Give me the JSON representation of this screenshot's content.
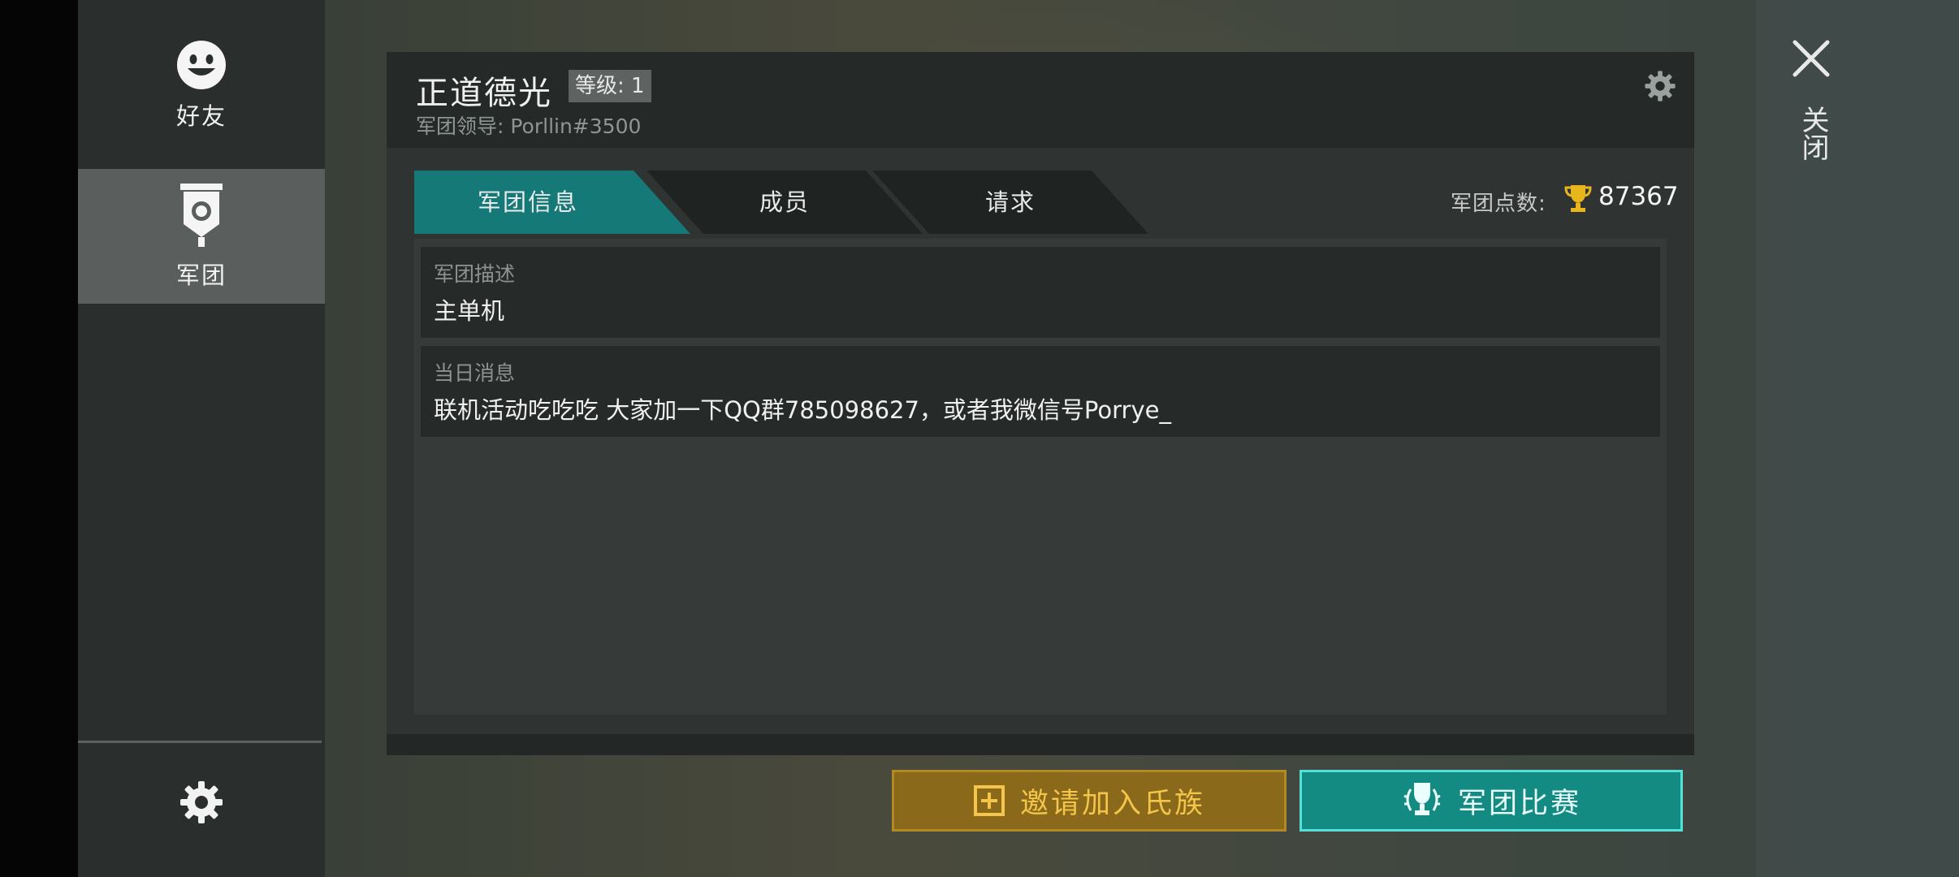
{
  "sidebar": {
    "friends_label": "好友",
    "legion_label": "军团"
  },
  "close": {
    "label": "关闭"
  },
  "panel": {
    "legion_name": "正道德光",
    "level_text": "等级: 1",
    "leader_text": "军团领导: Porllin#3500"
  },
  "tabs": [
    {
      "label": "军团信息",
      "active": true
    },
    {
      "label": "成员",
      "active": false
    },
    {
      "label": "请求",
      "active": false
    }
  ],
  "points": {
    "label": "军团点数:",
    "value": "87367"
  },
  "cards": {
    "description": {
      "title": "军团描述",
      "text": "主单机"
    },
    "motd": {
      "title": "当日消息",
      "text": "联机活动吃吃吃 大家加一下QQ群785098627，或者我微信号Porrye_"
    }
  },
  "buttons": {
    "invite_label": "邀请加入氏族",
    "match_label": "军团比赛"
  },
  "colors": {
    "accent_teal": "#147977",
    "invite_gold": "#8a6a1a",
    "trophy_gold": "#e8b51c"
  },
  "icons": {
    "friends": "smiley-icon",
    "legion": "banner-icon",
    "settings": "gear-icon",
    "close": "close-icon",
    "points": "trophy-icon",
    "invite": "plus-square-icon",
    "match": "trophy-laurel-icon"
  }
}
